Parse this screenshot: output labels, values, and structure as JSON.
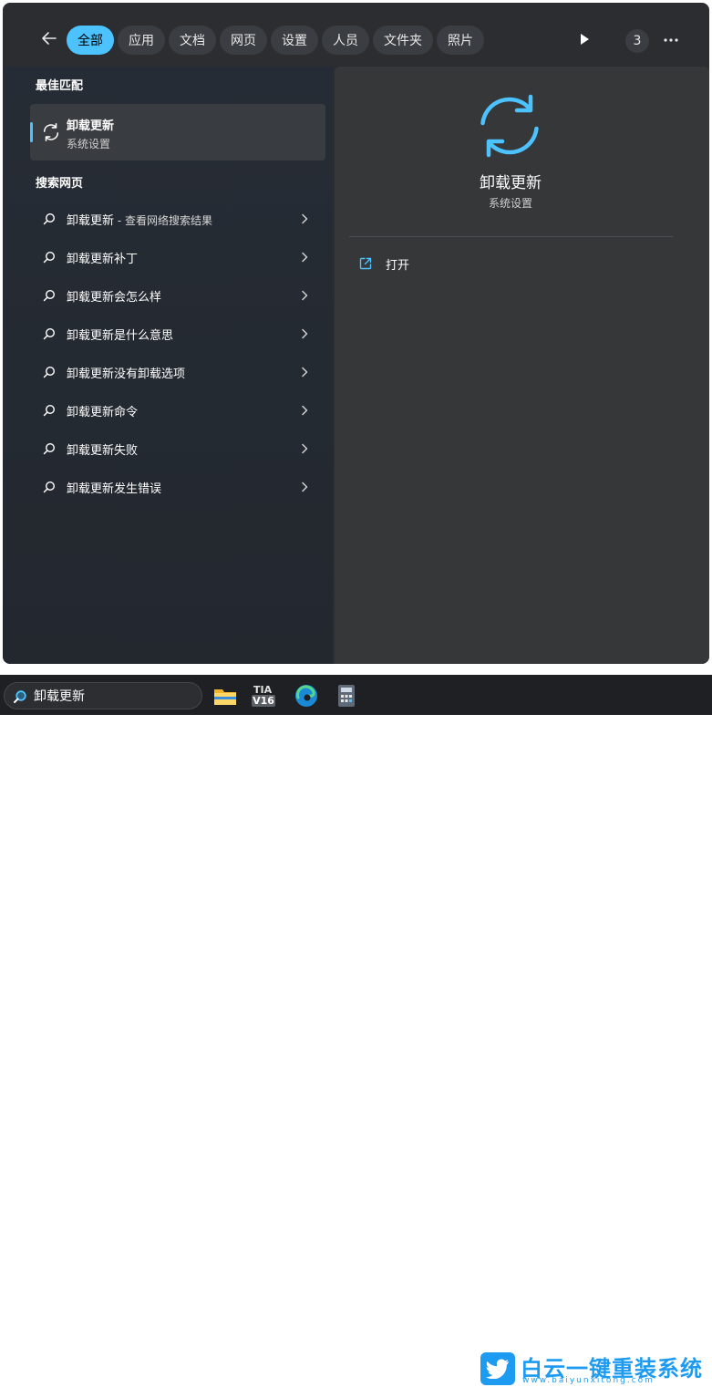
{
  "filters": {
    "tabs": [
      {
        "label": "全部",
        "active": true
      },
      {
        "label": "应用",
        "active": false
      },
      {
        "label": "文档",
        "active": false
      },
      {
        "label": "网页",
        "active": false
      },
      {
        "label": "设置",
        "active": false
      },
      {
        "label": "人员",
        "active": false
      },
      {
        "label": "文件夹",
        "active": false
      },
      {
        "label": "照片",
        "active": false
      }
    ],
    "badge_count": "3"
  },
  "best_match": {
    "section_title": "最佳匹配",
    "title": "卸载更新",
    "subtitle": "系统设置",
    "icon": "refresh-icon"
  },
  "web_search": {
    "section_title": "搜索网页",
    "items": [
      {
        "label": "卸载更新",
        "suffix": " - 查看网络搜索结果"
      },
      {
        "label": "卸载更新补丁",
        "suffix": ""
      },
      {
        "label": "卸载更新会怎么样",
        "suffix": ""
      },
      {
        "label": "卸载更新是什么意思",
        "suffix": ""
      },
      {
        "label": "卸载更新没有卸载选项",
        "suffix": ""
      },
      {
        "label": "卸载更新命令",
        "suffix": ""
      },
      {
        "label": "卸载更新失败",
        "suffix": ""
      },
      {
        "label": "卸载更新发生错误",
        "suffix": ""
      }
    ]
  },
  "preview": {
    "title": "卸载更新",
    "subtitle": "系统设置",
    "open_label": "打开"
  },
  "taskbar": {
    "search_value": "卸载更新",
    "tia_line1": "TIA",
    "tia_line2": "V16"
  },
  "watermark": {
    "title": "白云一键重装系统",
    "url": "www.baiyunxitong.com"
  },
  "colors": {
    "accent": "#4cc2ff",
    "panel_bg": "#2b2d30",
    "preview_bg": "#363738",
    "watermark_blue": "#1d9bf0"
  }
}
